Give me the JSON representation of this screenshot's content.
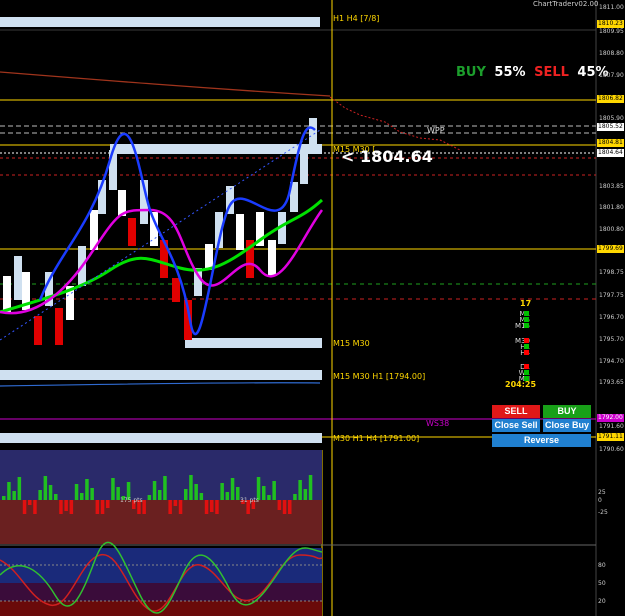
{
  "header": {
    "app_label": "ChartTraderv02.00"
  },
  "sentiment": {
    "buy_label": "BUY",
    "buy_pct": "55%",
    "sell_label": "SELL",
    "sell_pct": "45%",
    "buy_color": "#1c9e2c",
    "sell_color": "#ee2222"
  },
  "current_price": "< 1804.64",
  "labels": {
    "h1h4": "H1 H4 [7/8]",
    "m15m30_top": "M15 M30 [",
    "wpp": "WPP",
    "m15m30_mid": "M15 M30",
    "m15m30h1": "M15 M30 H1  [1794.00]",
    "ws38": "WS38",
    "m30h1h4": "M30 H1 H4  [1791.00]",
    "sub_175": "175 pts",
    "sub_31": "31 pts"
  },
  "price_axis": {
    "ticks": [
      "1811.00",
      "1809.95",
      "1808.80",
      "1807.90",
      "1805.90",
      "1803.85",
      "1801.80",
      "1800.80",
      "1798.75",
      "1797.75",
      "1796.70",
      "1795.70",
      "1794.70",
      "1793.65",
      "1791.60",
      "1790.60"
    ],
    "tags": [
      {
        "text": "1810.23",
        "color": "#ffd700",
        "fg": "#000"
      },
      {
        "text": "1806.82",
        "color": "#ffd700",
        "fg": "#000"
      },
      {
        "text": "1805.52",
        "color": "#ffffff",
        "fg": "#000"
      },
      {
        "text": "1804.81",
        "color": "#ffd700",
        "fg": "#000"
      },
      {
        "text": "1804.64",
        "color": "#ffffff",
        "fg": "#000"
      },
      {
        "text": "1799.69",
        "color": "#ffd700",
        "fg": "#000"
      },
      {
        "text": "1792.00",
        "color": "#cc00cc",
        "fg": "#fff"
      },
      {
        "text": "1791.11",
        "color": "#ffd700",
        "fg": "#000"
      }
    ]
  },
  "timeframe_panel": {
    "count": "17",
    "rows": [
      {
        "label": "M1",
        "color": "#00c000"
      },
      {
        "label": "M5",
        "color": "#00c000"
      },
      {
        "label": "M15",
        "color": "#00c000"
      },
      {
        "label": "M30",
        "color": "#ff0000"
      },
      {
        "label": "H1",
        "color": "#00c000"
      },
      {
        "label": "H4",
        "color": "#ff0000"
      },
      {
        "label": "D1",
        "color": "#ff0000"
      },
      {
        "label": "W1",
        "color": "#00c000"
      },
      {
        "label": "MN",
        "color": "#00c000"
      }
    ],
    "timer": "204:25"
  },
  "trade_buttons": {
    "sell": "SELL",
    "buy": "BUY",
    "close_sell": "Close Sell",
    "close_buy": "Close Buy",
    "reverse": "Reverse"
  },
  "sub1_axis": [
    "25",
    "0",
    "-25"
  ],
  "sub2_axis": [
    "80",
    "50",
    "20"
  ],
  "colors": {
    "background": "#000000",
    "level_yellow": "#ffd700",
    "zone_blue": "#cfe0f0",
    "ma_green": "#00e000",
    "ma_magenta": "#e000e0",
    "line_blue": "#1a3cff"
  }
}
